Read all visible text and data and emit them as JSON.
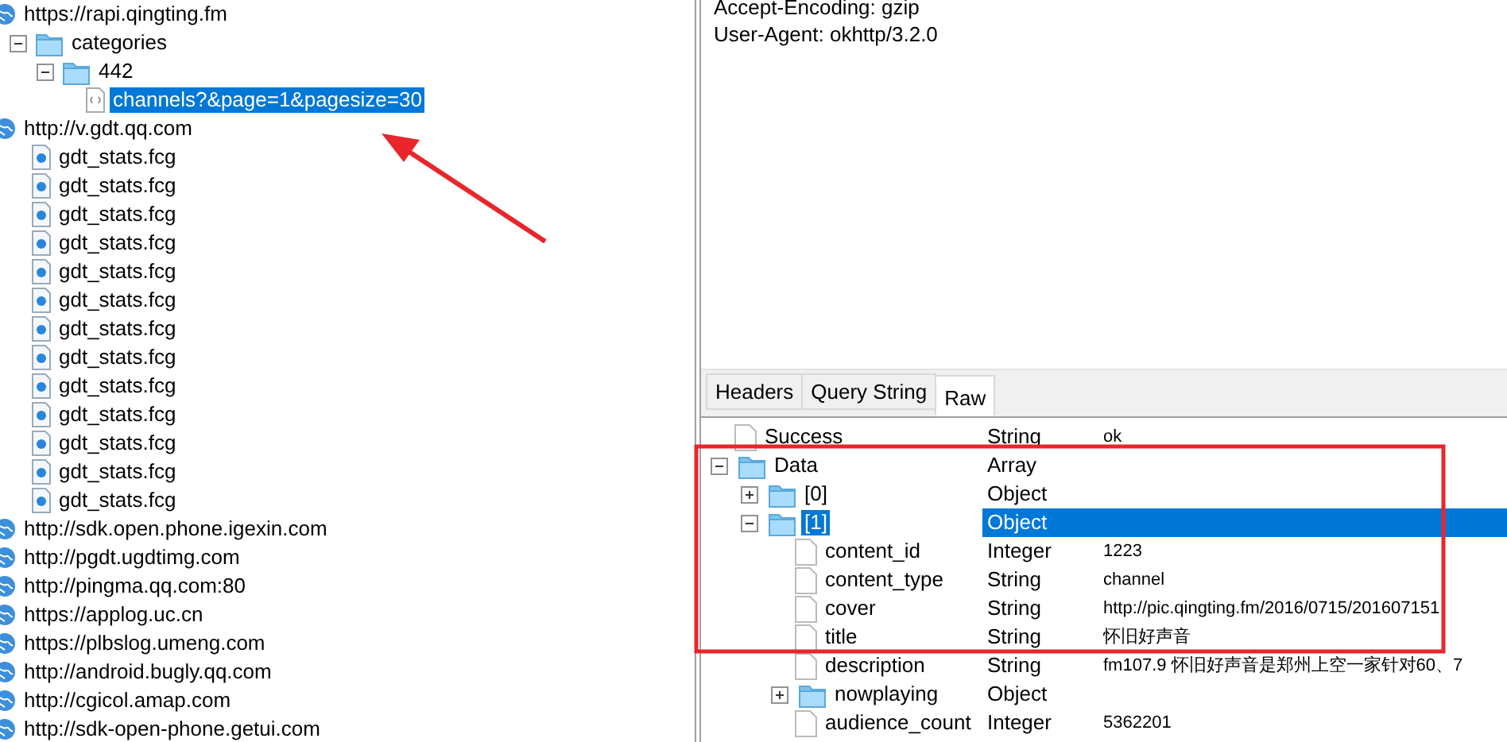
{
  "session_tree": [
    {
      "label": "https://rapi.qingting.fm",
      "kind": "host",
      "selected": false,
      "children": [
        {
          "label": "categories",
          "kind": "folder",
          "expanded": true,
          "selected": false,
          "children": [
            {
              "label": "442",
              "kind": "folder",
              "expanded": true,
              "selected": false,
              "children": [
                {
                  "label": "channels?&page=1&pagesize=30",
                  "kind": "request",
                  "selected": true
                }
              ]
            }
          ]
        }
      ]
    },
    {
      "label": "http://v.gdt.qq.com",
      "kind": "host",
      "selected": false,
      "children": [
        {
          "label": "gdt_stats.fcg",
          "kind": "file",
          "selected": false
        },
        {
          "label": "gdt_stats.fcg",
          "kind": "file",
          "selected": false
        },
        {
          "label": "gdt_stats.fcg",
          "kind": "file",
          "selected": false
        },
        {
          "label": "gdt_stats.fcg",
          "kind": "file",
          "selected": false
        },
        {
          "label": "gdt_stats.fcg",
          "kind": "file",
          "selected": false
        },
        {
          "label": "gdt_stats.fcg",
          "kind": "file",
          "selected": false
        },
        {
          "label": "gdt_stats.fcg",
          "kind": "file",
          "selected": false
        },
        {
          "label": "gdt_stats.fcg",
          "kind": "file",
          "selected": false
        },
        {
          "label": "gdt_stats.fcg",
          "kind": "file",
          "selected": false
        },
        {
          "label": "gdt_stats.fcg",
          "kind": "file",
          "selected": false
        },
        {
          "label": "gdt_stats.fcg",
          "kind": "file",
          "selected": false
        },
        {
          "label": "gdt_stats.fcg",
          "kind": "file",
          "selected": false
        },
        {
          "label": "gdt_stats.fcg",
          "kind": "file",
          "selected": false
        }
      ]
    },
    {
      "label": "http://sdk.open.phone.igexin.com",
      "kind": "host",
      "selected": false
    },
    {
      "label": "http://pgdt.ugdtimg.com",
      "kind": "host",
      "selected": false
    },
    {
      "label": "http://pingma.qq.com:80",
      "kind": "host",
      "selected": false
    },
    {
      "label": "https://applog.uc.cn",
      "kind": "host",
      "selected": false
    },
    {
      "label": "https://plbslog.umeng.com",
      "kind": "host",
      "selected": false
    },
    {
      "label": "http://android.bugly.qq.com",
      "kind": "host",
      "selected": false
    },
    {
      "label": "http://cgicol.amap.com",
      "kind": "host",
      "selected": false
    },
    {
      "label": "http://sdk-open-phone.getui.com",
      "kind": "host",
      "selected": false
    }
  ],
  "request_headers": [
    "Accept-Encoding: gzip",
    "User-Agent: okhttp/3.2.0"
  ],
  "tabs": [
    {
      "label": "Headers",
      "selected": false
    },
    {
      "label": "Query String",
      "selected": false
    },
    {
      "label": "Raw",
      "selected": true
    }
  ],
  "json_tree": [
    {
      "name": "Success",
      "type": "String",
      "value": "ok",
      "kind": "leaf",
      "selected": false
    },
    {
      "name": "Data",
      "type": "Array",
      "kind": "node",
      "expanded": true,
      "selected": false,
      "children": [
        {
          "name": "[0]",
          "type": "Object",
          "kind": "node",
          "expanded": false,
          "selected": false
        },
        {
          "name": "[1]",
          "type": "Object",
          "kind": "node",
          "expanded": true,
          "selected": true,
          "children": [
            {
              "name": "content_id",
              "type": "Integer",
              "value": "1223",
              "kind": "leaf",
              "selected": false
            },
            {
              "name": "content_type",
              "type": "String",
              "value": "channel",
              "kind": "leaf",
              "selected": false
            },
            {
              "name": "cover",
              "type": "String",
              "value": "http://pic.qingting.fm/2016/0715/201607151",
              "kind": "leaf",
              "selected": false
            },
            {
              "name": "title",
              "type": "String",
              "value": "怀旧好声音",
              "kind": "leaf",
              "selected": false
            },
            {
              "name": "description",
              "type": "String",
              "value": "fm107.9 怀旧好声音是郑州上空一家针对60、7",
              "kind": "leaf",
              "selected": false
            },
            {
              "name": "nowplaying",
              "type": "Object",
              "kind": "node",
              "expanded": false,
              "selected": false
            },
            {
              "name": "audience_count",
              "type": "Integer",
              "value": "5362201",
              "kind": "leaf",
              "selected": false
            }
          ]
        }
      ]
    }
  ]
}
